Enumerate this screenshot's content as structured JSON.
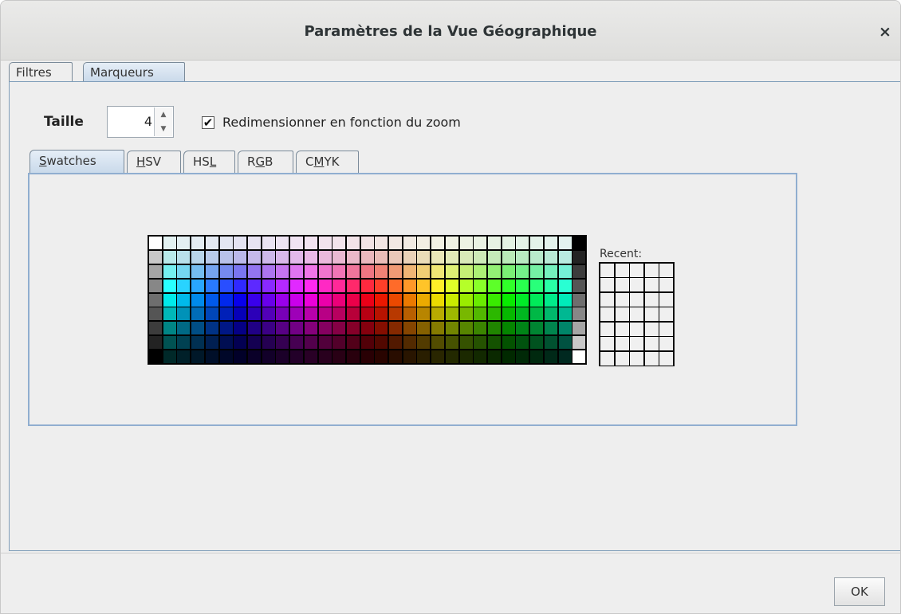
{
  "window": {
    "title": "Paramètres de la Vue Géographique",
    "close_glyph": "×"
  },
  "outer_tabs": [
    {
      "label": "Filtres",
      "selected": false
    },
    {
      "label": "Marqueurs",
      "selected": true
    }
  ],
  "size": {
    "label": "Taille",
    "value": "4",
    "up_glyph": "▲",
    "down_glyph": "▼"
  },
  "rescale": {
    "label": "Redimensionner en fonction du zoom",
    "checked": true,
    "check_glyph": "✔"
  },
  "color_tabs": [
    {
      "pre": "",
      "mn": "S",
      "post": "watches",
      "selected": true
    },
    {
      "pre": "",
      "mn": "H",
      "post": "SV",
      "selected": false
    },
    {
      "pre": "HS",
      "mn": "L",
      "post": "",
      "selected": false
    },
    {
      "pre": "R",
      "mn": "G",
      "post": "B",
      "selected": false
    },
    {
      "pre": "C",
      "mn": "M",
      "post": "YK",
      "selected": false
    }
  ],
  "swatches": {
    "columns": 31,
    "rows": 9
  },
  "recent": {
    "label": "Recent:",
    "columns": 5,
    "rows": 7,
    "color": "#f0f0f0"
  },
  "footer": {
    "ok_label": "OK"
  },
  "colors": {
    "accent": "#c9d9ea",
    "panel_border": "#7f9db9"
  }
}
